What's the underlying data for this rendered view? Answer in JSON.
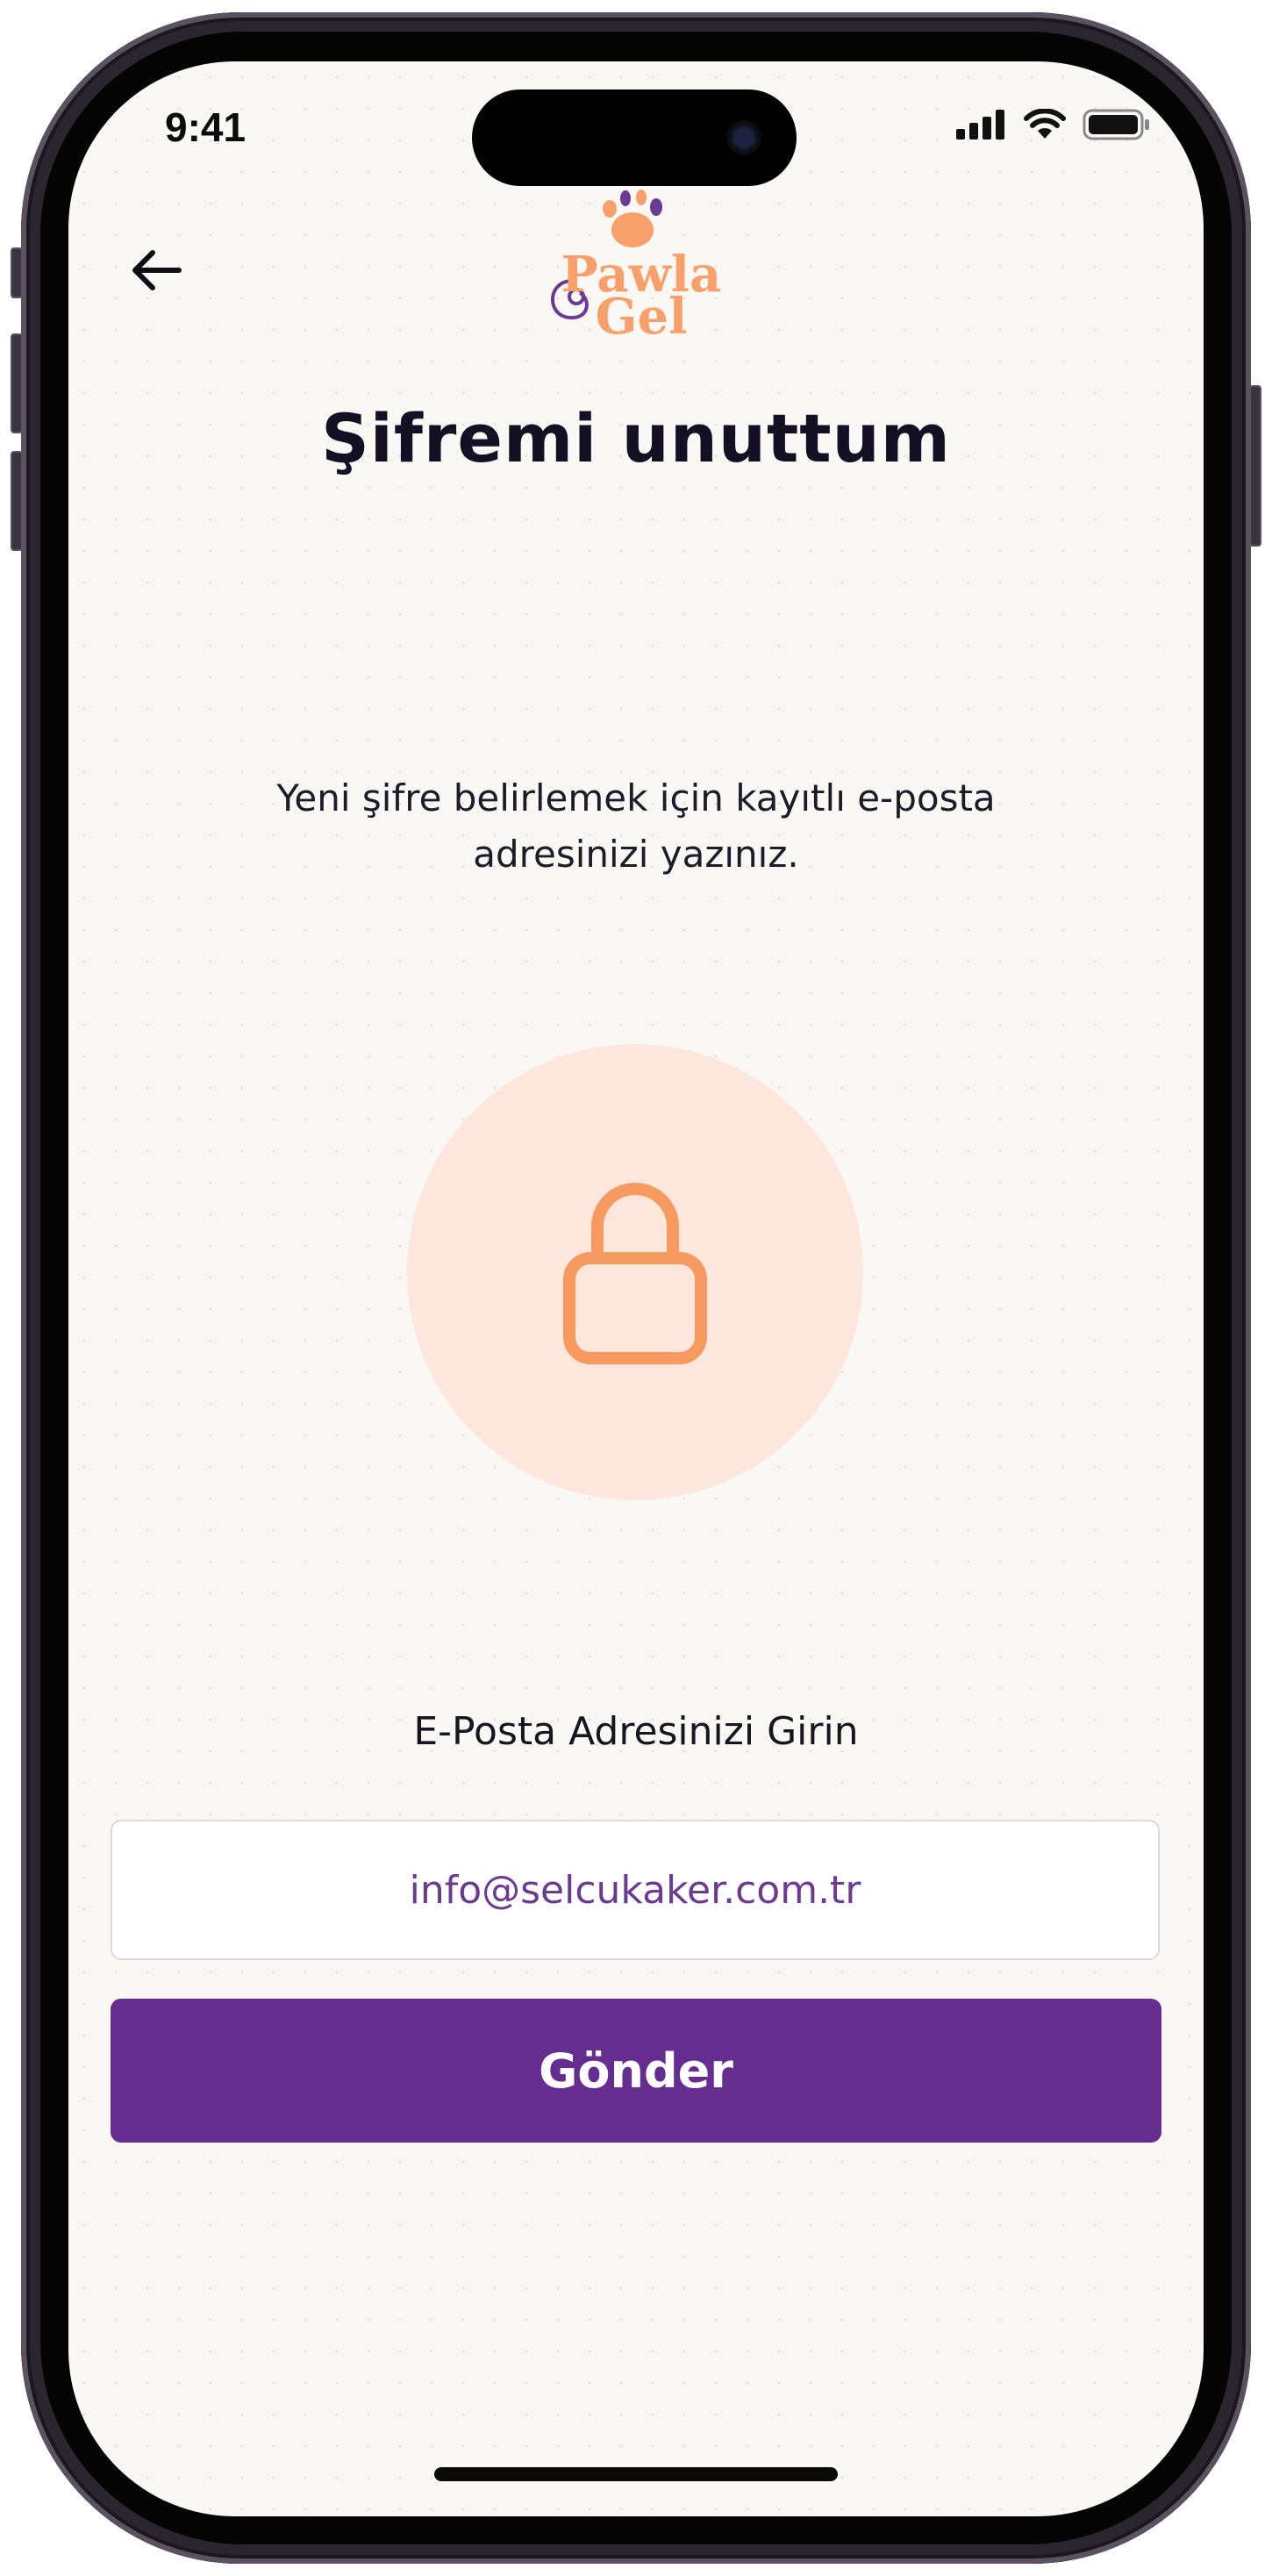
{
  "status_bar": {
    "time": "9:41",
    "icons": [
      "cellular-signal-icon",
      "wifi-icon",
      "battery-icon"
    ]
  },
  "header": {
    "back_icon": "arrow-left-icon",
    "logo": {
      "line1": "Pawla",
      "line2": "Gel"
    }
  },
  "page": {
    "title": "Şifremi unuttum",
    "subtitle_line1": "Yeni şifre belirlemek için kayıtlı e-posta",
    "subtitle_line2": "adresinizi yazınız.",
    "illustration_icon": "lock-icon"
  },
  "form": {
    "email_label": "E-Posta Adresinizi Girin",
    "email_value": "info@selcukaker.com.tr",
    "submit_label": "Gönder"
  },
  "colors": {
    "background": "#faf8f5",
    "brand_purple": "#662d91",
    "brand_orange": "#f7a06a",
    "lock_circle": "#fde7dc",
    "title_text": "#121022",
    "email_text": "#6b3a93"
  }
}
